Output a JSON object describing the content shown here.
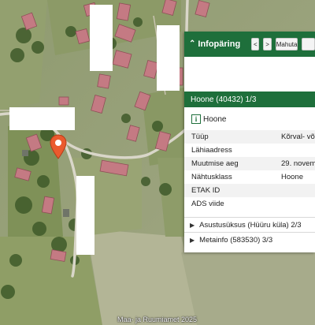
{
  "map": {
    "attribution": "Maa- ja Ruumiamet 2025",
    "marker_icon": "map-pin-icon"
  },
  "panel": {
    "title": "Infopäring",
    "collapse_icon": "double-chevron-up-icon",
    "prev_label": "<",
    "next_label": ">",
    "fit_label": "Mahuta",
    "more_label": "",
    "section_title": "Hoone (40432) 1/3",
    "object_icon": "info-icon",
    "object_icon_glyph": "i",
    "object_name": "Hoone",
    "attributes": [
      {
        "key": "Tüüp",
        "value": "Kõrval- võ"
      },
      {
        "key": "Lähiaadress",
        "value": ""
      },
      {
        "key": "Muutmise aeg",
        "value": "29. novem"
      },
      {
        "key": "Nähtusklass",
        "value": "Hoone"
      },
      {
        "key": "ETAK ID",
        "value": ""
      },
      {
        "key": "ADS viide",
        "value": ""
      }
    ],
    "collapsed_sections": [
      {
        "label": "Asustusüksus (Hüüru küla) 2/3"
      },
      {
        "label": "Metainfo (583530) 3/3"
      }
    ],
    "colors": {
      "header": "#1e6f3b",
      "accent": "#1e6f3b"
    }
  }
}
